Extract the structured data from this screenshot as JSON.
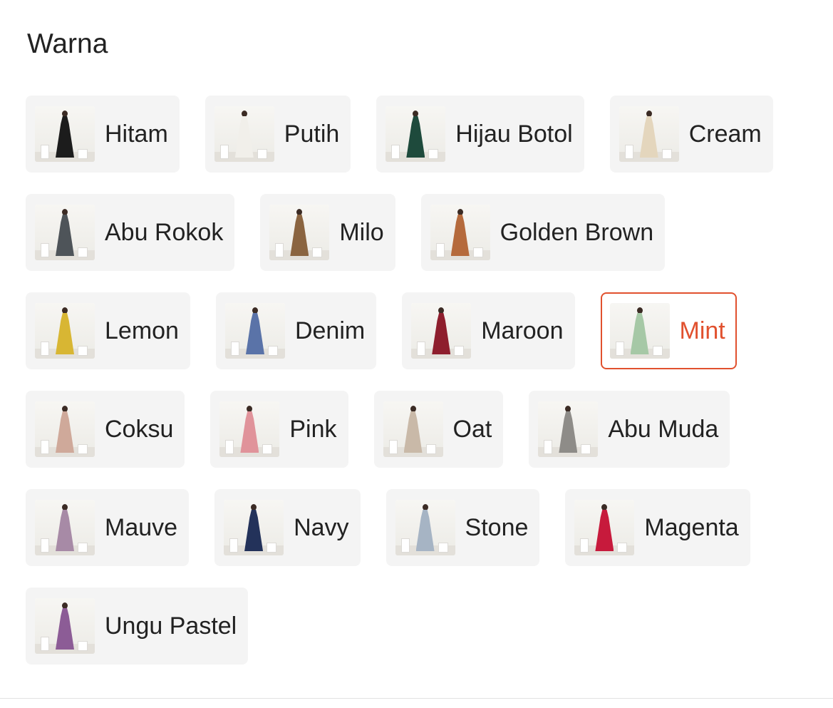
{
  "section_title": "Warna",
  "selected_label": "Mint",
  "accent_color": "#e1512e",
  "rows": [
    [
      {
        "label": "Hitam",
        "dress_color": "#1c1c1c"
      },
      {
        "label": "Putih",
        "dress_color": "#f1efea"
      },
      {
        "label": "Hijau Botol",
        "dress_color": "#1e4a3c"
      },
      {
        "label": "Cream",
        "dress_color": "#e4d6bd"
      }
    ],
    [
      {
        "label": "Abu Rokok",
        "dress_color": "#4e5459"
      },
      {
        "label": "Milo",
        "dress_color": "#8a6440"
      },
      {
        "label": "Golden Brown",
        "dress_color": "#b56a3c"
      }
    ],
    [
      {
        "label": "Lemon",
        "dress_color": "#d8b633"
      },
      {
        "label": "Denim",
        "dress_color": "#5a73a8"
      },
      {
        "label": "Maroon",
        "dress_color": "#8e1e2d"
      },
      {
        "label": "Mint",
        "dress_color": "#a6c8a6"
      }
    ],
    [
      {
        "label": "Coksu",
        "dress_color": "#cfa99a"
      },
      {
        "label": "Pink",
        "dress_color": "#e0939a"
      },
      {
        "label": "Oat",
        "dress_color": "#c9b9a8"
      },
      {
        "label": "Abu Muda",
        "dress_color": "#8e8c88"
      }
    ],
    [
      {
        "label": "Mauve",
        "dress_color": "#a78aa6"
      },
      {
        "label": "Navy",
        "dress_color": "#23325a"
      },
      {
        "label": "Stone",
        "dress_color": "#a6b4c4"
      },
      {
        "label": "Magenta",
        "dress_color": "#c71a3c"
      }
    ],
    [
      {
        "label": "Ungu Pastel",
        "dress_color": "#8c5c96"
      }
    ]
  ]
}
